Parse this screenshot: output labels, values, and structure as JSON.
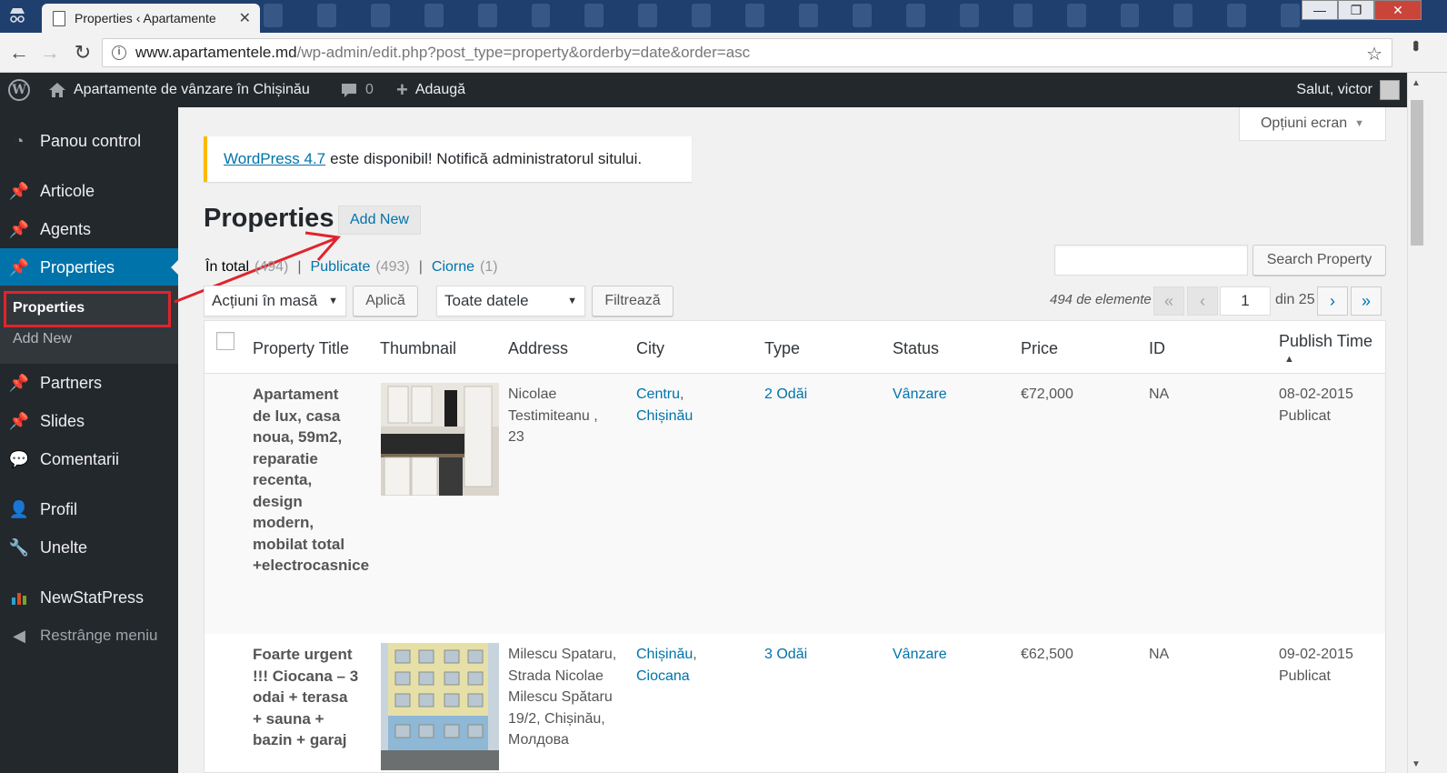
{
  "browser": {
    "tab_title": "Properties ‹ Apartamente",
    "tab_close": "✕",
    "url_host": "www.apartamentele.md",
    "url_path": "/wp-admin/edit.php?post_type=property&orderby=date&order=asc"
  },
  "adminbar": {
    "site_name": "Apartamente de vânzare în Chișinău",
    "comments_count": "0",
    "new_label": "Adaugă",
    "greeting": "Salut, victor"
  },
  "sidebar": {
    "items": [
      {
        "label": "Panou control",
        "icon": "dashboard-icon"
      },
      {
        "label": "Articole",
        "icon": "pin-icon"
      },
      {
        "label": "Agents",
        "icon": "pin-icon"
      },
      {
        "label": "Properties",
        "icon": "pin-icon"
      },
      {
        "label": "Partners",
        "icon": "pin-icon"
      },
      {
        "label": "Slides",
        "icon": "pin-icon"
      },
      {
        "label": "Comentarii",
        "icon": "comment-icon"
      },
      {
        "label": "Profil",
        "icon": "user-icon"
      },
      {
        "label": "Unelte",
        "icon": "wrench-icon"
      },
      {
        "label": "NewStatPress",
        "icon": "chart-icon"
      },
      {
        "label": "Restrânge meniu",
        "icon": "collapse-icon"
      }
    ],
    "submenu": [
      {
        "label": "Properties"
      },
      {
        "label": "Add New"
      }
    ]
  },
  "screen_options": "Opțiuni ecran",
  "notice": {
    "link": "WordPress 4.7",
    "text": "este disponibil! Notifică administratorul sitului."
  },
  "page": {
    "title": "Properties",
    "add_new": "Add New"
  },
  "filters": {
    "all_label": "În total",
    "all_count": "(494)",
    "published_label": "Publicate",
    "published_count": "(493)",
    "drafts_label": "Ciorne",
    "drafts_count": "(1)",
    "separator": "|"
  },
  "search": {
    "button": "Search Property",
    "value": ""
  },
  "bulk": {
    "action": "Acțiuni în masă",
    "apply": "Aplică",
    "dates": "Toate datele",
    "filter": "Filtrează"
  },
  "pagination": {
    "count_text": "494 de elemente",
    "first": "«",
    "prev": "‹",
    "current": "1",
    "of_text": "din 25",
    "next": "›",
    "last": "»"
  },
  "table": {
    "columns": [
      "Property Title",
      "Thumbnail",
      "Address",
      "City",
      "Type",
      "Status",
      "Price",
      "ID",
      "Publish Time"
    ],
    "sort_indicator": "▲",
    "rows": [
      {
        "title": "Apartament de lux, casa noua, 59m2, reparatie recenta, design modern, mobilat total +electrocasnice",
        "address": "Nicolae Testimiteanu , 23",
        "city1": "Centru",
        "city2": "Chișinău",
        "type": "2 Odăi",
        "status": "Vânzare",
        "price": "€72,000",
        "id": "NA",
        "date": "08-02-2015",
        "state": "Publicat"
      },
      {
        "title": "Foarte urgent !!! Ciocana – 3 odai + terasa + sauna + bazin + garaj",
        "address": "Milescu Spataru, Strada Nicolae Milescu Spătaru 19/2, Chișinău, Молдова",
        "city1": "Chișinău",
        "city2": "Ciocana",
        "type": "3 Odăi",
        "status": "Vânzare",
        "price": "€62,500",
        "id": "NA",
        "date": "09-02-2015",
        "state": "Publicat"
      }
    ]
  },
  "colors": {
    "accent": "#0073aa",
    "adminbar": "#23282d",
    "highlight": "#e0242c",
    "notice": "#ffb900"
  }
}
